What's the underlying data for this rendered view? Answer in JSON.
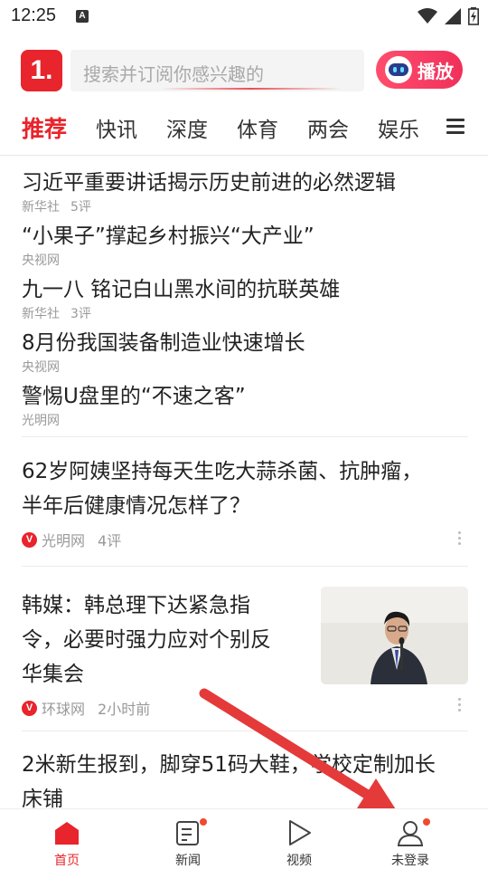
{
  "status_bar": {
    "time": "12:25",
    "notification_icon": "A"
  },
  "header": {
    "logo_text": "1.",
    "search_placeholder": "搜索并订阅你感兴趣的",
    "play_label": "播放"
  },
  "tabs": [
    "推荐",
    "快讯",
    "深度",
    "体育",
    "两会",
    "娱乐"
  ],
  "active_tab": "推荐",
  "headlines": [
    {
      "title": "习近平重要讲话揭示历史前进的必然逻辑",
      "source": "新华社",
      "comments": "5评"
    },
    {
      "title": "“小果子”撑起乡村振兴“大产业”",
      "source": "央视网",
      "comments": ""
    },
    {
      "title": "九一八 铭记白山黑水间的抗联英雄",
      "source": "新华社",
      "comments": "3评"
    },
    {
      "title": "8月份我国装备制造业快速增长",
      "source": "央视网",
      "comments": ""
    },
    {
      "title": "警惕U盘里的“不速之客”",
      "source": "光明网",
      "comments": ""
    }
  ],
  "articles": [
    {
      "title_lines": [
        "62岁阿姨坚持每天生吃大蒜杀菌、抗肿瘤，",
        "半年后健康情况怎样了？"
      ],
      "source": "光明网",
      "extra": "4评",
      "badge": "V"
    },
    {
      "title_lines": [
        "韩媒：韩总理下达紧急指",
        "令，必要时强力应对个别反",
        "华集会"
      ],
      "source": "环球网",
      "extra": "2小时前",
      "badge": "V"
    },
    {
      "title_lines": [
        "2米新生报到，脚穿51码大鞋，学校定制加长",
        "床铺"
      ],
      "source": "",
      "extra": "",
      "badge": ""
    }
  ],
  "bottom_nav": [
    {
      "label": "首页",
      "icon": "home-icon",
      "active": true,
      "dot": false
    },
    {
      "label": "新闻",
      "icon": "news-icon",
      "active": false,
      "dot": true
    },
    {
      "label": "视频",
      "icon": "video-play-icon",
      "active": false,
      "dot": false
    },
    {
      "label": "未登录",
      "icon": "user-icon",
      "active": false,
      "dot": true
    }
  ],
  "colors": {
    "accent": "#e8242c",
    "arrow": "#e53a3a"
  }
}
